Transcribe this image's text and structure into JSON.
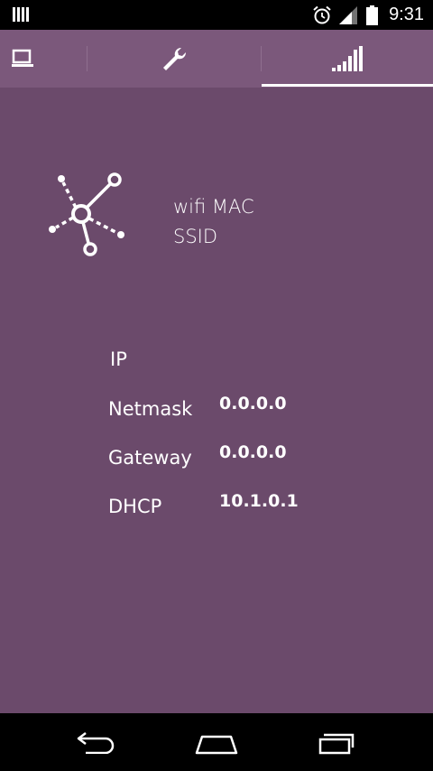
{
  "status_bar": {
    "time": "9:31",
    "icons": [
      "notification-bars-icon",
      "alarm-icon",
      "signal-icon",
      "battery-icon"
    ]
  },
  "tabs": [
    {
      "icon": "laptop-icon",
      "selected": false
    },
    {
      "icon": "wrench-icon",
      "selected": false
    },
    {
      "icon": "signal-bars-icon",
      "selected": true
    }
  ],
  "wifi": {
    "mac_label": "wifi MAC",
    "ssid_label": "SSID"
  },
  "network": {
    "ip_label": "IP",
    "netmask_label": "Netmask",
    "netmask_value": "0.0.0.0",
    "gateway_label": "Gateway",
    "gateway_value": "0.0.0.0",
    "dhcp_label": "DHCP",
    "dhcp_value": "10.1.0.1"
  },
  "nav": {
    "buttons": [
      "back-icon",
      "home-icon",
      "recents-icon"
    ]
  },
  "colors": {
    "background": "#6b4a6b",
    "tab_bar": "#7b587b",
    "indicator": "#ffffff"
  }
}
